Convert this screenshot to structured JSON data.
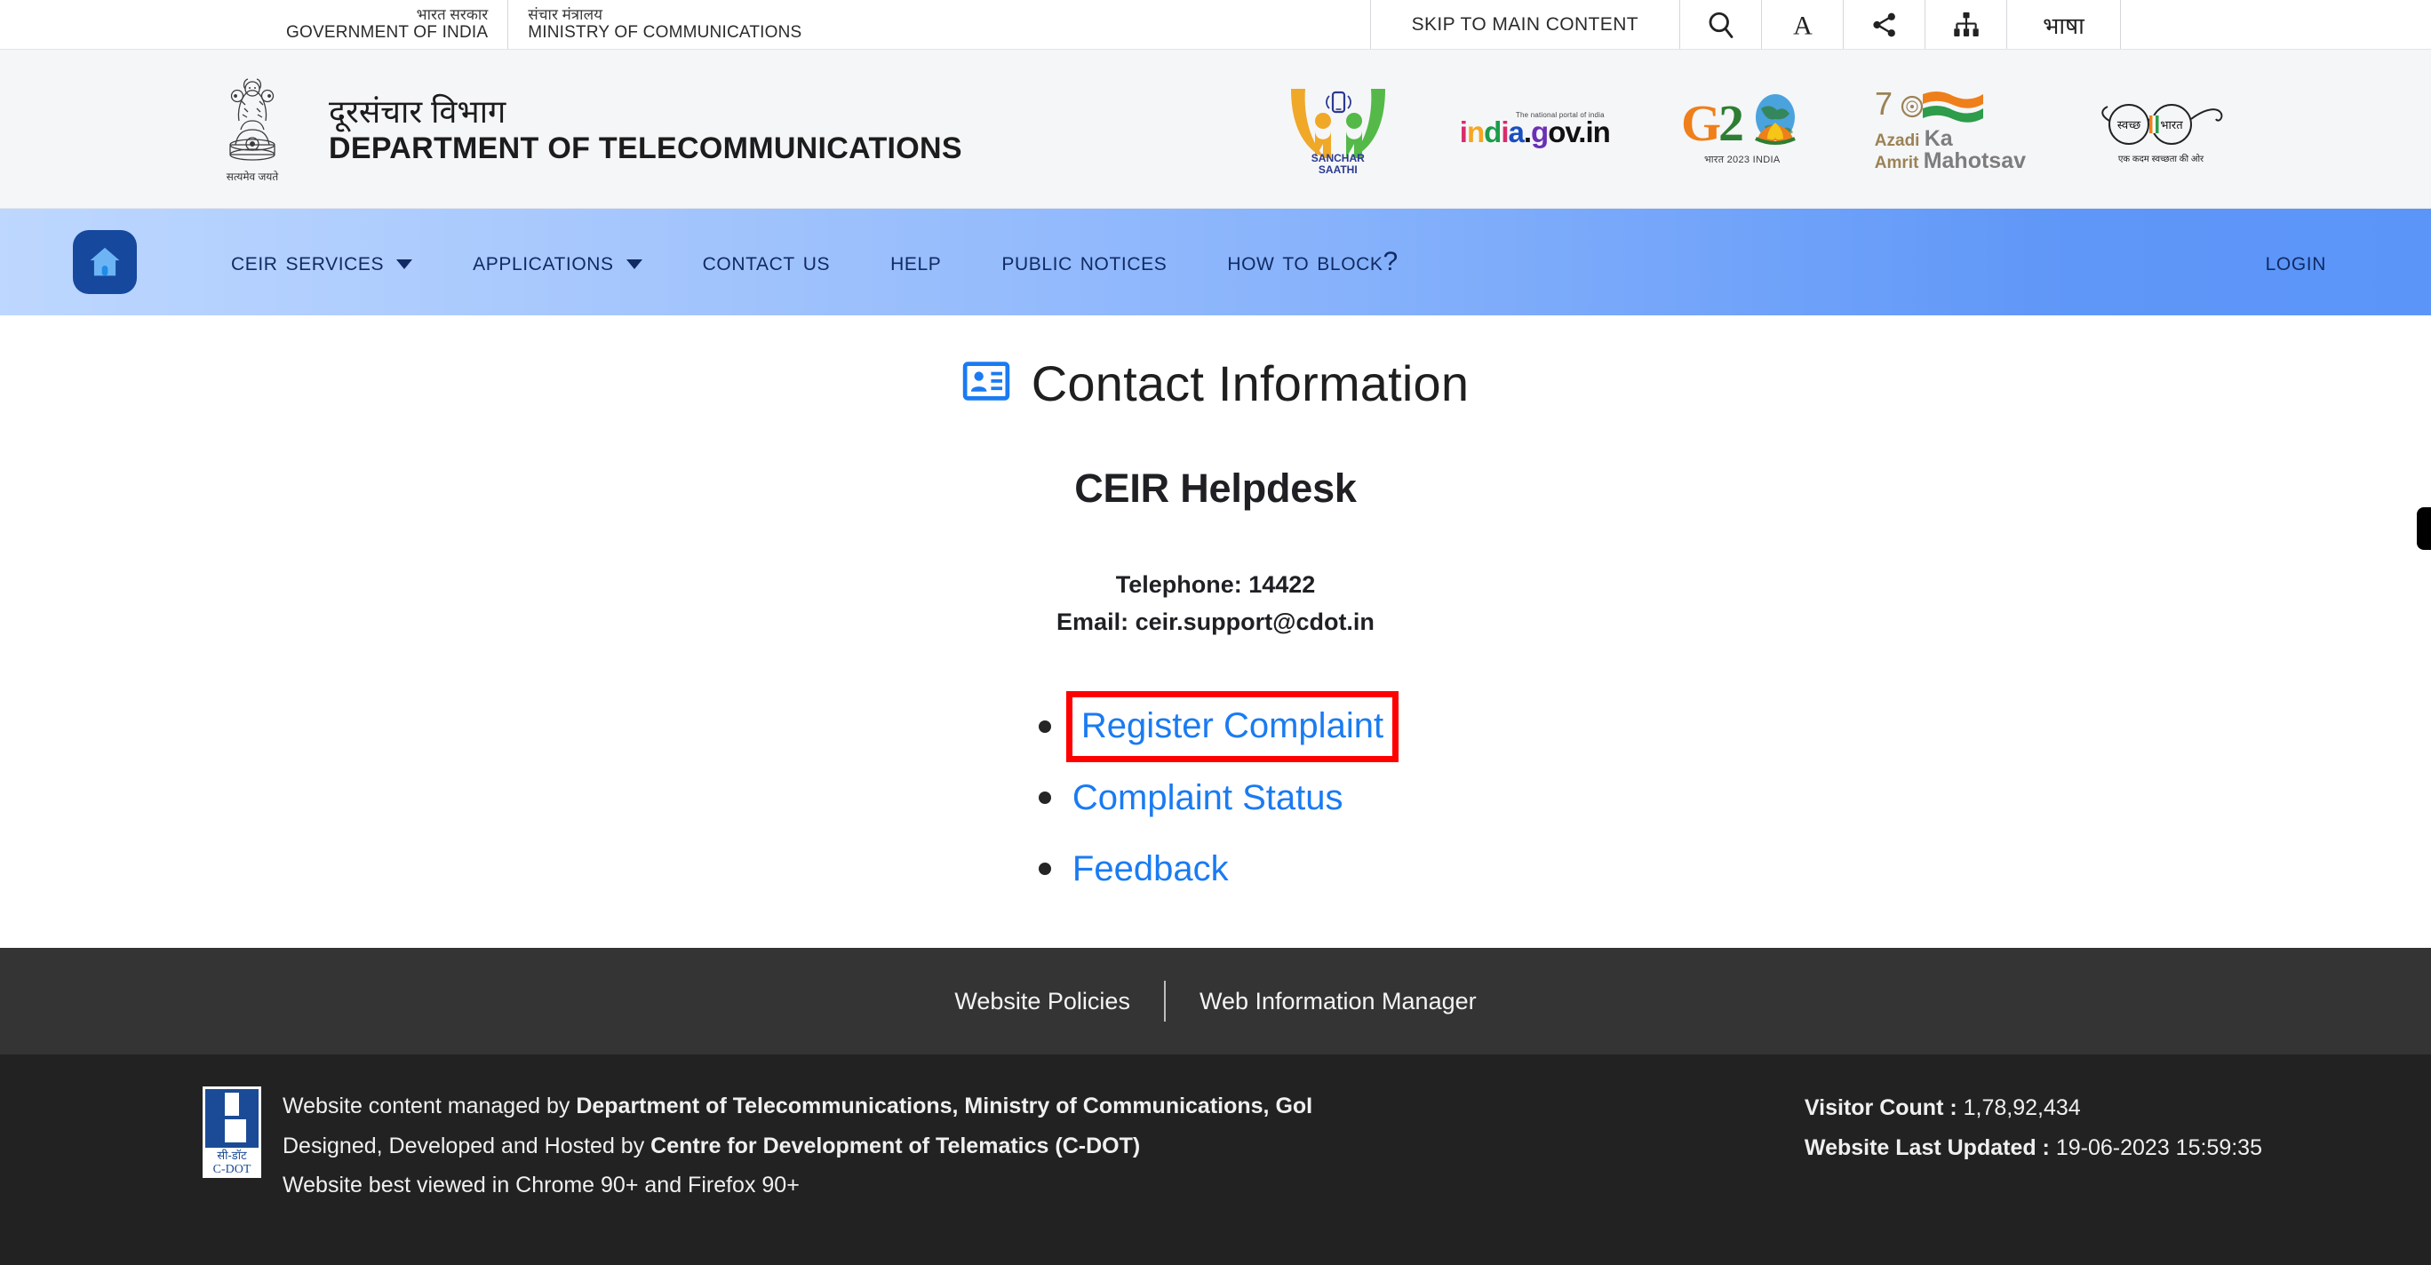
{
  "topbar": {
    "gov_hindi": "भारत सरकार",
    "gov_english": "GOVERNMENT OF INDIA",
    "ministry_hindi": "संचार मंत्रालय",
    "ministry_english": "MINISTRY OF COMMUNICATIONS",
    "skip_link": "SKIP TO MAIN CONTENT",
    "icons": {
      "search": "search-icon",
      "font_size": "font-size-icon",
      "share": "share-icon",
      "sitemap": "sitemap-icon"
    },
    "language_label": "भाषा"
  },
  "masthead": {
    "emblem_caption": "सत्यमेव जयते",
    "dept_hindi": "दूरसंचार विभाग",
    "dept_english": "DEPARTMENT OF TELECOMMUNICATIONS",
    "logos": [
      {
        "name": "sanchar-saathi-logo",
        "line1": "SANCHAR",
        "line2": "SAATHI"
      },
      {
        "name": "india-gov-in-logo",
        "tagline": "The national portal of india",
        "text": "india.gov.in"
      },
      {
        "name": "g20-logo",
        "text": "G20",
        "subtext": "भारत 2023 INDIA"
      },
      {
        "name": "azadi-ka-amrit-mahotsav-logo",
        "num": "75",
        "line1": "Azadi",
        "line2": "Ka",
        "line3": "Amrit",
        "line4": "Mahotsav"
      },
      {
        "name": "swachh-bharat-logo",
        "lens1": "स्वच्छ",
        "lens2": "भारत",
        "caption": "एक कदम स्वच्छता की ओर"
      }
    ]
  },
  "nav": {
    "home_icon": "home-icon",
    "items": [
      {
        "label": "CEIR Services",
        "has_dropdown": true
      },
      {
        "label": "Applications",
        "has_dropdown": true
      },
      {
        "label": "Contact Us",
        "has_dropdown": false
      },
      {
        "label": "Help",
        "has_dropdown": false
      },
      {
        "label": "Public Notices",
        "has_dropdown": false
      },
      {
        "label": "How to block?",
        "has_dropdown": false
      }
    ],
    "login_label": "Login"
  },
  "main": {
    "title_icon": "contact-card-icon",
    "title": "Contact Information",
    "section_title": "CEIR Helpdesk",
    "telephone": "Telephone: 14422",
    "email": "Email: ceir.support@cdot.in",
    "links": [
      {
        "label": "Register Complaint",
        "highlighted": true
      },
      {
        "label": "Complaint Status",
        "highlighted": false
      },
      {
        "label": "Feedback",
        "highlighted": false
      }
    ],
    "highlight_color": "#ff0000",
    "link_color": "#1a7bf2"
  },
  "footer": {
    "links": [
      "Website Policies",
      "Web Information Manager"
    ],
    "cdot_logo": {
      "hindi": "सी-डॉट",
      "english": "C-DOT"
    },
    "line1_prefix": "Website content managed by ",
    "line1_bold": "Department of Telecommunications, Ministry of Communications, GoI",
    "line2_prefix": "Designed, Developed and Hosted by ",
    "line2_bold": "Centre for Development of Telematics (C-DOT)",
    "line3": "Website best viewed in Chrome 90+ and Firefox 90+",
    "visitor_label": "Visitor Count : ",
    "visitor_count": "1,78,92,434",
    "updated_label": "Website Last Updated : ",
    "updated_value": "19-06-2023 15:59:35"
  }
}
